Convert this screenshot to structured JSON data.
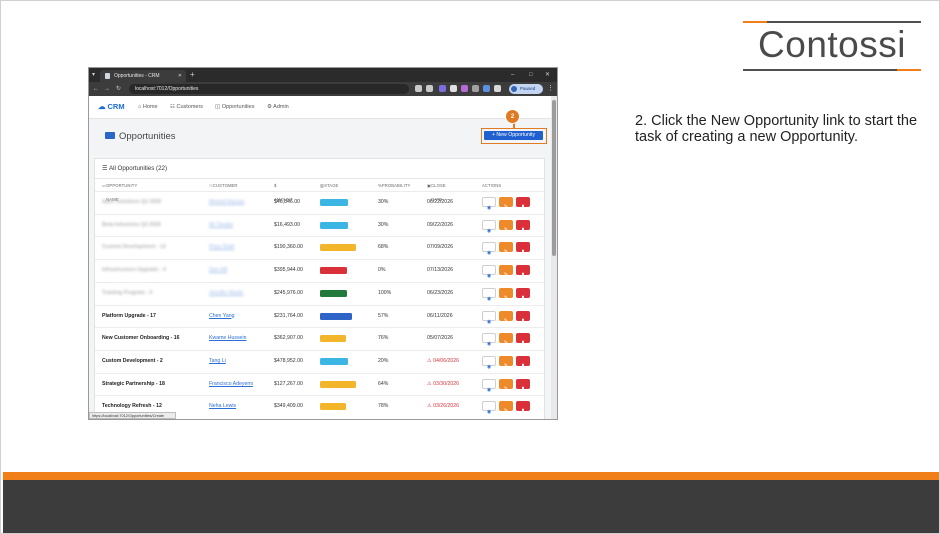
{
  "logo": {
    "text": "Contossi"
  },
  "instruction": "2. Click the New Opportunity link to start the task of creating a new Opportunity.",
  "browser": {
    "tab_title": "Opportunities - CRM",
    "url": "localhost:7012/Opportunities",
    "profile_label": "Paused",
    "status_url": "https://localhost:7012/Opportunities/Create"
  },
  "app": {
    "brand": "CRM",
    "nav": [
      "Home",
      "Customers",
      "Opportunities",
      "Admin"
    ],
    "page_title": "Opportunities",
    "new_button": "+ New Opportunity",
    "step_marker": "2",
    "card_title": "All Opportunities (22)",
    "columns": [
      "OPPORTUNITY NAME",
      "CUSTOMER",
      "$ AMOUNT",
      "STAGE",
      "PROBABILITY",
      "CLOSE DATE",
      "ACTIONS"
    ],
    "rows": [
      {
        "name": "Apex Solutions Q1 2026",
        "customer": "Ahmed Hassan",
        "amount": "$46,846.00",
        "stage": "Qualification",
        "stage_color": "#3bb6e4",
        "probability": "30%",
        "close_date": "06/22/2026",
        "overdue": false,
        "blurred": true
      },
      {
        "name": "Beta Industries Q2 2026",
        "customer": "Ali Tanaka",
        "amount": "$16,493.00",
        "stage": "Qualification",
        "stage_color": "#3bb6e4",
        "probability": "30%",
        "close_date": "09/22/2026",
        "overdue": false,
        "blurred": true
      },
      {
        "name": "Custom Development - 13",
        "customer": "Priya Shah",
        "amount": "$190,360.00",
        "stage": "Value Proposition",
        "stage_color": "#f3b529",
        "probability": "68%",
        "close_date": "07/09/2026",
        "overdue": false,
        "blurred": true
      },
      {
        "name": "Infrastructure Upgrade - 4",
        "customer": "Dan Hill",
        "amount": "$395,944.00",
        "stage": "Closed Lost",
        "stage_color": "#d9303a",
        "probability": "0%",
        "close_date": "07/13/2026",
        "overdue": false,
        "blurred": true
      },
      {
        "name": "Training Program - 5",
        "customer": "Jennifer Martin",
        "amount": "$245,976.00",
        "stage": "Closed Won",
        "stage_color": "#217a3c",
        "probability": "100%",
        "close_date": "06/23/2026",
        "overdue": false,
        "blurred": true
      },
      {
        "name": "Platform Upgrade - 17",
        "customer": "Chen Yang",
        "amount": "$231,764.00",
        "stage": "Needs Analysis",
        "stage_color": "#2e64c8",
        "probability": "57%",
        "close_date": "06/11/2026",
        "overdue": false,
        "blurred": false
      },
      {
        "name": "New Customer Onboarding - 16",
        "customer": "Kwame Hussein",
        "amount": "$362,907.00",
        "stage": "Negotiation",
        "stage_color": "#f3b529",
        "probability": "76%",
        "close_date": "05/07/2026",
        "overdue": false,
        "blurred": false
      },
      {
        "name": "Custom Development - 2",
        "customer": "Tang Li",
        "amount": "$478,952.00",
        "stage": "Qualification",
        "stage_color": "#3bb6e4",
        "probability": "20%",
        "close_date": "04/06/2026",
        "overdue": true,
        "blurred": false
      },
      {
        "name": "Strategic Partnership - 18",
        "customer": "Francisco Adeyemi",
        "amount": "$127,267.00",
        "stage": "Value Proposition",
        "stage_color": "#f3b529",
        "probability": "64%",
        "close_date": "03/30/2026",
        "overdue": true,
        "blurred": false
      },
      {
        "name": "Technology Refresh - 12",
        "customer": "Neha Lewis",
        "amount": "$349,409.00",
        "stage": "Negotiation",
        "stage_color": "#f3b529",
        "probability": "78%",
        "close_date": "03/26/2026",
        "overdue": true,
        "blurred": false
      }
    ]
  }
}
